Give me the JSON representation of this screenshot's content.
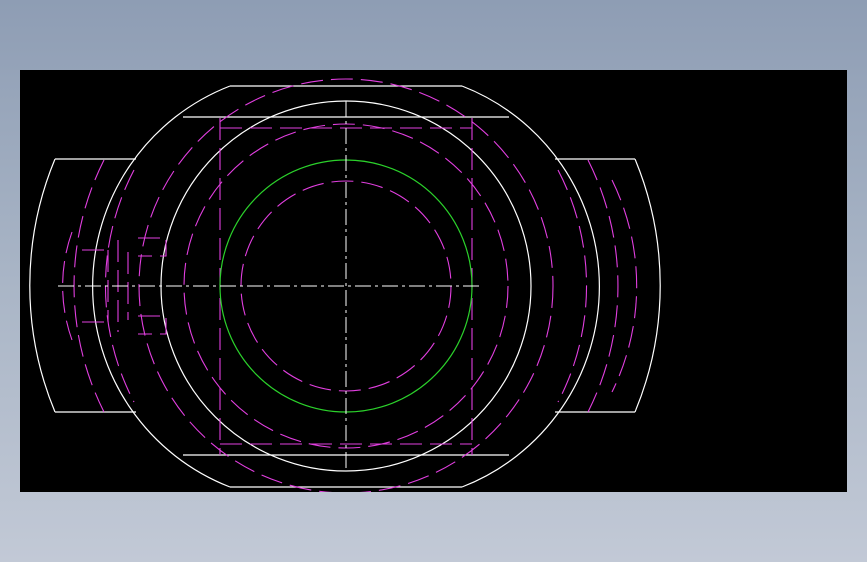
{
  "viewer": {
    "background_color": "#9aa8bd",
    "canvas_color": "#000000"
  },
  "drawing": {
    "line_colors": {
      "outline": "#ffffff",
      "hidden": "#e23fe0",
      "bore": "#2bd12b",
      "centerline": "#ffffff"
    }
  }
}
